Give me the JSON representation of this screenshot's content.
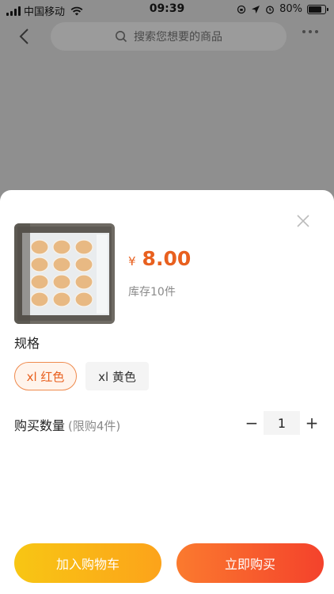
{
  "status_bar": {
    "carrier": "中国移动",
    "time": "09:39",
    "battery": "80%"
  },
  "nav": {
    "search_placeholder": "搜索您想要的商品"
  },
  "product": {
    "currency": "¥",
    "price": "8.00",
    "stock": "库存10件"
  },
  "spec": {
    "title": "规格",
    "options": [
      {
        "label": "xl 红色",
        "selected": true
      },
      {
        "label": "xl 黄色",
        "selected": false
      }
    ]
  },
  "quantity": {
    "label": "购买数量",
    "limit": "(限购4件)",
    "value": "1",
    "minus": "−",
    "plus": "+"
  },
  "actions": {
    "add_to_cart": "加入购物车",
    "buy_now": "立即购买"
  },
  "colors": {
    "accent": "#e8601f",
    "cart": "#f8c614",
    "buy": "#f4422c"
  }
}
